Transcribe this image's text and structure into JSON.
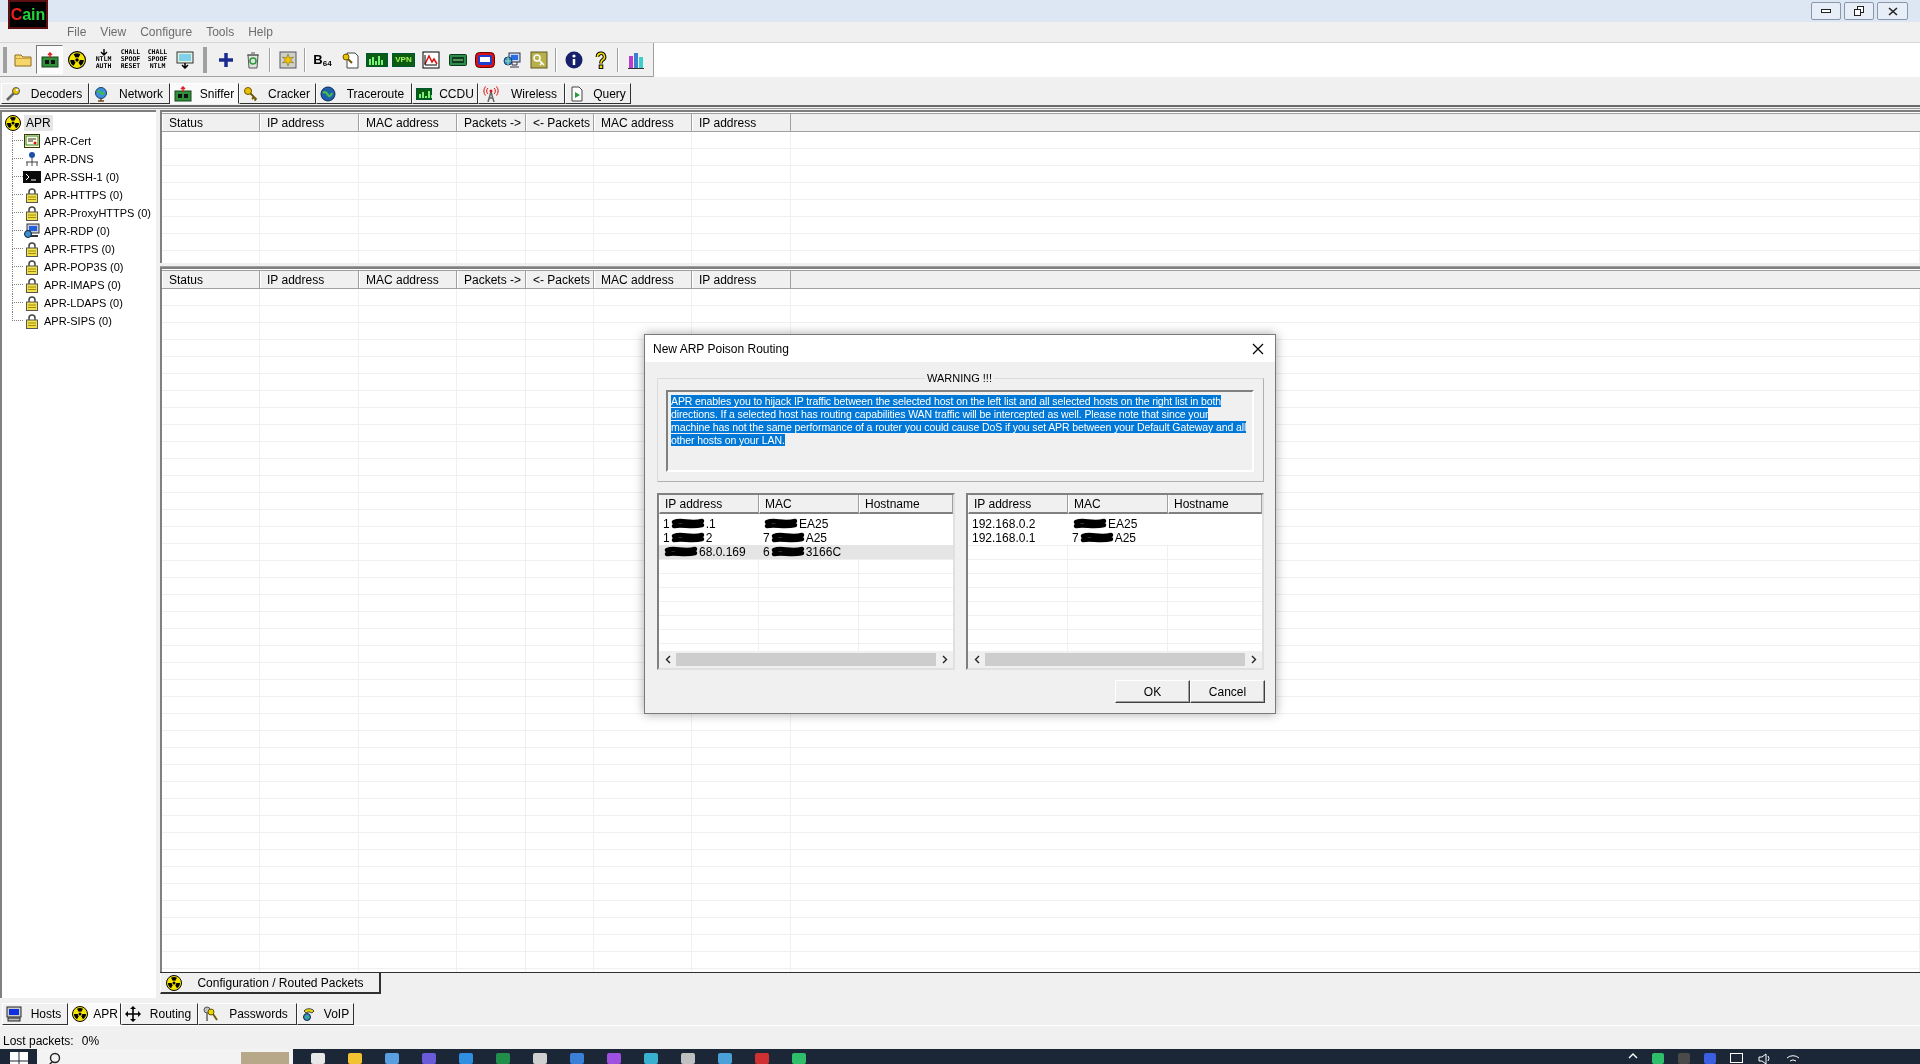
{
  "window": {
    "logo": [
      {
        "text": "C",
        "color": "#e8201c"
      },
      {
        "text": "ain",
        "color": "#22d33a"
      }
    ]
  },
  "menu": [
    {
      "label": "File"
    },
    {
      "label": "View"
    },
    {
      "label": "Configure"
    },
    {
      "label": "Tools"
    },
    {
      "label": "Help"
    }
  ],
  "toolbar": {
    "groups": [
      [
        {
          "kind": "icon"
        },
        {
          "kind": "toggle",
          "pressed": true
        },
        {
          "kind": "toggle",
          "pressed": false
        },
        {
          "kind": "caption",
          "label": "NTLM AUTH"
        },
        {
          "kind": "caption",
          "label": "CHALL SPOOF RESET"
        },
        {
          "kind": "caption",
          "label": "CHALL SPOOF NTLM"
        },
        {
          "kind": "icon"
        }
      ],
      [
        {
          "kind": "icon"
        },
        {
          "kind": "icon"
        }
      ],
      [
        {
          "kind": "icon"
        }
      ],
      [
        {
          "kind": "letter",
          "label": "B$_{64}$"
        },
        {
          "kind": "icon"
        },
        {
          "kind": "icon"
        },
        {
          "kind": "tile",
          "label": "VPN"
        },
        {
          "kind": "icon"
        },
        {
          "kind": "icon"
        },
        {
          "kind": "icon"
        },
        {
          "kind": "icon"
        },
        {
          "kind": "icon"
        }
      ],
      [
        {
          "kind": "icon"
        },
        {
          "kind": "icon"
        }
      ],
      [
        {
          "kind": "icon"
        }
      ]
    ]
  },
  "tabs": [
    {
      "label": "Decoders",
      "selected": false
    },
    {
      "label": "Network",
      "selected": false
    },
    {
      "label": "Sniffer",
      "selected": true
    },
    {
      "label": "Cracker",
      "selected": false
    },
    {
      "label": "Traceroute",
      "selected": false
    },
    {
      "label": "CCDU",
      "selected": false
    },
    {
      "label": "Wireless",
      "selected": false
    },
    {
      "label": "Query",
      "selected": false
    }
  ],
  "tree": {
    "label": "APR",
    "selected": true,
    "children": [
      {
        "label": "APR-Cert",
        "selected": false
      },
      {
        "label": "APR-DNS",
        "selected": false
      },
      {
        "label": "APR-SSH-1 (0)",
        "selected": false
      },
      {
        "label": "APR-HTTPS (0)",
        "selected": false
      },
      {
        "label": "APR-ProxyHTTPS (0)",
        "selected": false
      },
      {
        "label": "APR-RDP (0)",
        "selected": false
      },
      {
        "label": "APR-FTPS (0)",
        "selected": false
      },
      {
        "label": "APR-POP3S (0)",
        "selected": false
      },
      {
        "label": "APR-IMAPS (0)",
        "selected": false
      },
      {
        "label": "APR-LDAPS (0)",
        "selected": false
      },
      {
        "label": "APR-SIPS (0)",
        "selected": false
      }
    ]
  },
  "upper_table": {
    "columns": [
      "Status",
      "IP address",
      "MAC address",
      "Packets ->",
      "<- Packets",
      "MAC address",
      "IP address"
    ]
  },
  "lower_table": {
    "columns": [
      "Status",
      "IP address",
      "MAC address",
      "Packets ->",
      "<- Packets",
      "MAC address",
      "IP address"
    ]
  },
  "panel_tabs": [
    {
      "label": "Configuration / Routed Packets",
      "selected": true
    }
  ],
  "bottom_tabs": [
    {
      "label": "Hosts",
      "selected": false
    },
    {
      "label": "APR",
      "selected": true
    },
    {
      "label": "Routing",
      "selected": false
    },
    {
      "label": "Passwords",
      "selected": false
    },
    {
      "label": "VoIP",
      "selected": false
    }
  ],
  "status_bar": {
    "label": "Lost packets:",
    "value": "0%"
  },
  "dialog": {
    "title": "New ARP Poison Routing",
    "warning": {
      "title": "WARNING !!!",
      "text": "APR enables you to hijack IP traffic between the selected host on the left list and all selected hosts on the right list in both directions. If a selected host has routing capabilities WAN traffic will be intercepted as well. Please note that since your machine has not the same performance of a router you could cause DoS if you set APR between your Default Gateway and all other hosts on your LAN.",
      "text_selected": true
    },
    "left_list": {
      "columns": [
        "IP address",
        "MAC",
        "Hostname"
      ],
      "rows": [
        {
          "selected": false,
          "ip_address": [
            {
              "kind": "text",
              "text": "1"
            },
            {
              "kind": "redacted"
            },
            {
              "kind": "text",
              "text": ".1"
            }
          ],
          "mac": [
            {
              "kind": "redacted"
            },
            {
              "kind": "text",
              "text": "EA25"
            }
          ]
        },
        {
          "selected": false,
          "ip_address": [
            {
              "kind": "text",
              "text": "1"
            },
            {
              "kind": "redacted"
            },
            {
              "kind": "text",
              "text": "2"
            }
          ],
          "mac": [
            {
              "kind": "text",
              "text": "7"
            },
            {
              "kind": "redacted"
            },
            {
              "kind": "text",
              "text": "A25"
            }
          ]
        },
        {
          "selected": true,
          "ip_address": [
            {
              "kind": "redacted"
            },
            {
              "kind": "text",
              "text": "68.0.169"
            }
          ],
          "mac": [
            {
              "kind": "text",
              "text": "6"
            },
            {
              "kind": "redacted"
            },
            {
              "kind": "text",
              "text": "3166C"
            }
          ]
        }
      ]
    },
    "right_list": {
      "columns": [
        "IP address",
        "MAC",
        "Hostname"
      ],
      "rows": [
        {
          "selected": false,
          "ip_address": [
            {
              "kind": "text",
              "text": "192.168.0.2"
            }
          ],
          "mac": [
            {
              "kind": "redacted"
            },
            {
              "kind": "text",
              "text": "EA25"
            }
          ]
        },
        {
          "selected": false,
          "ip_address": [
            {
              "kind": "text",
              "text": "192.168.0.1"
            }
          ],
          "mac": [
            {
              "kind": "text",
              "text": "7"
            },
            {
              "kind": "redacted"
            },
            {
              "kind": "text",
              "text": "A25"
            }
          ]
        }
      ]
    },
    "buttons": [
      {
        "label": "OK"
      },
      {
        "label": "Cancel"
      }
    ]
  }
}
